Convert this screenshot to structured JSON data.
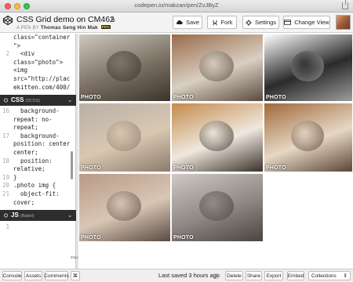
{
  "browser": {
    "url": "codepen.io/makzan/pen/ZvJByZ"
  },
  "header": {
    "title": "CSS Grid demo on CM462",
    "byline_prefix": "A PEN BY",
    "author": "Thomas Seng Hin Mak",
    "badge": "PRO",
    "buttons": {
      "save": "Save",
      "fork": "Fork",
      "settings": "Settings",
      "change_view": "Change View"
    }
  },
  "editor": {
    "html_lines": [
      {
        "n": "",
        "t": "class=\"container"
      },
      {
        "n": "",
        "t": "\">"
      },
      {
        "n": "2",
        "t": "  <div"
      },
      {
        "n": "",
        "t": "class=\"photo\">"
      },
      {
        "n": "",
        "t": "<img"
      },
      {
        "n": "",
        "t": "src=\"http://plac"
      },
      {
        "n": "",
        "t": "ekitten.com/400/"
      }
    ],
    "css_pane": {
      "name": "CSS",
      "sub": "(SCSS)"
    },
    "css_lines": [
      {
        "n": "16",
        "t": "  background-"
      },
      {
        "n": "",
        "t": "repeat: no-"
      },
      {
        "n": "",
        "t": "repeat;"
      },
      {
        "n": "17",
        "t": "  background-"
      },
      {
        "n": "",
        "t": "position: center"
      },
      {
        "n": "",
        "t": "center;"
      },
      {
        "n": "18",
        "t": "  position:"
      },
      {
        "n": "",
        "t": "relative;"
      },
      {
        "n": "19",
        "t": "}"
      },
      {
        "n": "20",
        "t": ".photo img {"
      },
      {
        "n": "21",
        "t": "  object-fit:"
      },
      {
        "n": "",
        "t": "cover;"
      }
    ],
    "js_pane": {
      "name": "JS",
      "sub": "(Babel)"
    },
    "js_lines": [
      {
        "n": "1",
        "t": ""
      }
    ]
  },
  "preview": {
    "photo_label": "PHOTO",
    "tiles": [
      {
        "label": "PHOTO",
        "colors": [
          "#cfc9c0",
          "#7a6f62",
          "#3b342d"
        ]
      },
      {
        "label": "PHOTO",
        "colors": [
          "#9a6b4a",
          "#d8cfc2",
          "#5a4a3c"
        ]
      },
      {
        "label": "PHOTO",
        "colors": [
          "#ffffff",
          "#2b2b2b",
          "#9c9c9c"
        ]
      },
      {
        "label": "PHOTO",
        "colors": [
          "#b8b0a8",
          "#d9c7b0",
          "#8a7b6c"
        ]
      },
      {
        "label": "PHOTO",
        "colors": [
          "#c58a4a",
          "#efe8df",
          "#3a3029"
        ]
      },
      {
        "label": "PHOTO",
        "colors": [
          "#a0683a",
          "#e6d8c4",
          "#5b4636"
        ]
      },
      {
        "label": "PHOTO",
        "colors": [
          "#b89a86",
          "#d8c6b5",
          "#5a4a42"
        ]
      },
      {
        "label": "PHOTO",
        "colors": [
          "#cfcac6",
          "#8e8783",
          "#4a4442"
        ]
      }
    ],
    "extra_label": "",
    "editor_width_label": "80px"
  },
  "footer": {
    "console": "Console",
    "assets": "Assets",
    "comments": "Comments",
    "shortcut": "⌘",
    "saved": "Last saved 3 hours ago",
    "delete": "Delete",
    "share": "Share",
    "export": "Export",
    "embed": "Embed",
    "collections": "Collections",
    "collections_chevron": "⇕"
  },
  "colors": {
    "header_bg": "#f4f4f4",
    "pane_header_bg": "#2d2d2d",
    "pro_badge": "#ffd13c"
  }
}
